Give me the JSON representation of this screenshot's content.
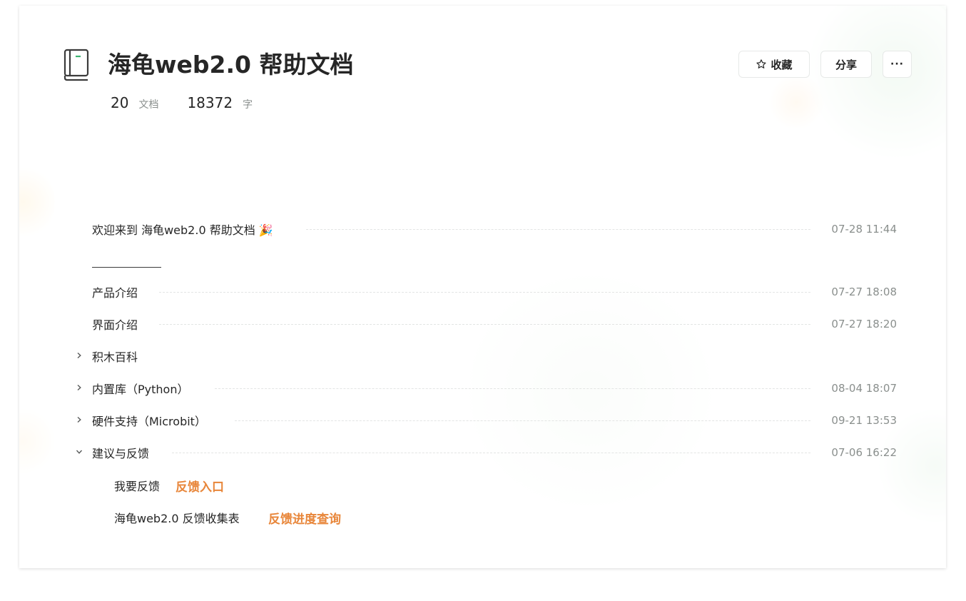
{
  "book": {
    "title": "海龟web2.0 帮助文档",
    "icon": "book-icon",
    "stats": {
      "docs_count": "20",
      "docs_unit": "文档",
      "words_count": "18372",
      "words_unit": "字"
    }
  },
  "actions": {
    "favorite_label": "收藏",
    "favorite_icon": "star-icon",
    "share_label": "分享",
    "more_label": "···"
  },
  "toc": {
    "welcome": {
      "title": "欢迎来到 海龟web2.0 帮助文档 🎉",
      "time": "07-28 11:44"
    },
    "divider": "——————",
    "product": {
      "title": "产品介绍",
      "time": "07-27 18:08"
    },
    "interface": {
      "title": "界面介绍",
      "time": "07-27 18:20"
    },
    "blocks": {
      "title": "积木百科",
      "expanded": false
    },
    "builtin": {
      "title": "内置库（Python）",
      "time": "08-04 18:07",
      "expanded": false
    },
    "hardware": {
      "title": "硬件支持（Microbit）",
      "time": "09-21 13:53",
      "expanded": false
    },
    "feedback": {
      "title": "建议与反馈",
      "time": "07-06 16:22",
      "expanded": true
    },
    "feedback_entry": {
      "text": "我要反馈",
      "link": "反馈入口"
    },
    "feedback_form": {
      "text": "海龟web2.0 反馈收集表",
      "link": "反馈进度查询"
    }
  },
  "colors": {
    "accent_orange": "#e8863a",
    "book_icon_green": "#3cb371",
    "text_primary": "#262626",
    "text_secondary": "#8a8f8d"
  }
}
